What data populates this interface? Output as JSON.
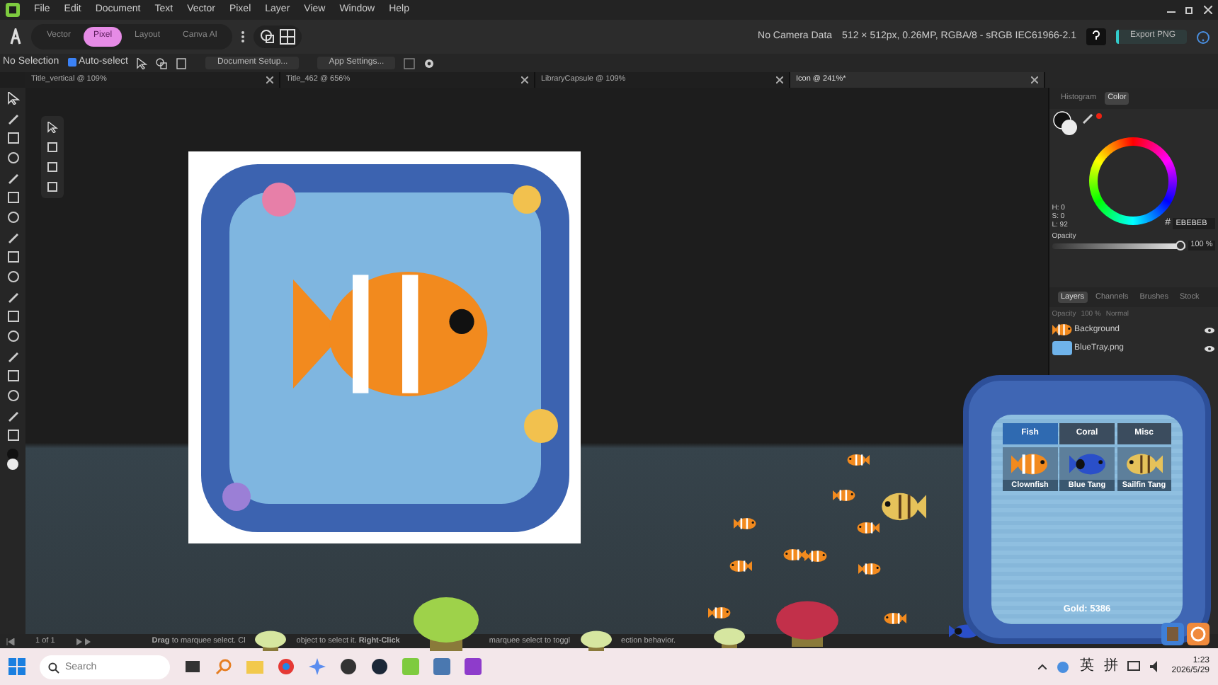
{
  "menu": [
    "File",
    "Edit",
    "Document",
    "Text",
    "Vector",
    "Pixel",
    "Layer",
    "View",
    "Window",
    "Help"
  ],
  "personas": [
    {
      "label": "Vector",
      "selected": false
    },
    {
      "label": "Pixel",
      "selected": true
    },
    {
      "label": "Layout",
      "selected": false
    },
    {
      "label": "Canva AI",
      "selected": false
    }
  ],
  "toolbar_info": [
    "No Camera Data",
    "512 × 512px, 0.26MP, RGBA/8 - sRGB IEC61966-2.1"
  ],
  "export_button": "Export PNG",
  "context_bar": {
    "selection": "No Selection",
    "auto_select": {
      "label": "Auto-select",
      "checked": true
    },
    "buttons": [
      "Document Setup...",
      "App Settings..."
    ]
  },
  "document_tabs": [
    {
      "title": "Title_vertical @ 109%",
      "selected": false
    },
    {
      "title": "Title_462 @ 656%",
      "selected": false
    },
    {
      "title": "LibraryCapsule @ 109%",
      "selected": false
    },
    {
      "title": "Icon @ 241%*",
      "selected": true
    }
  ],
  "color_panel": {
    "tabs": [
      {
        "label": "Histogram",
        "selected": false
      },
      {
        "label": "Color",
        "selected": true
      }
    ],
    "hsl": [
      "H: 0",
      "S: 0",
      "L: 92"
    ],
    "hex_prefix": "#",
    "hex": "EBEBEB",
    "opacity_label": "Opacity",
    "opacity": {
      "level": 1,
      "reading": "100 %"
    }
  },
  "layers_panel": {
    "tabs": [
      {
        "label": "Layers",
        "selected": true
      },
      {
        "label": "Channels",
        "selected": false
      },
      {
        "label": "Brushes",
        "selected": false
      },
      {
        "label": "Stock",
        "selected": false
      }
    ],
    "opacity_label": "Opacity",
    "opacity": "100 %",
    "blend_mode": "Normal",
    "layers": [
      {
        "name": "Background",
        "kind": "fish"
      },
      {
        "name": "BlueTray.png",
        "kind": "tray"
      }
    ]
  },
  "status_bar": {
    "page": "1 of 1",
    "hint_parts": [
      "**Drag** to marquee select. Cl",
      "object to select it. **Right-Click**",
      "marquee select to toggl",
      "ection behavior."
    ]
  },
  "aquarium_shop": {
    "tabs": [
      {
        "label": "Fish",
        "selected": true
      },
      {
        "label": "Coral",
        "selected": false
      },
      {
        "label": "Misc",
        "selected": false
      }
    ],
    "items": [
      {
        "name": "Clownfish",
        "kind": "clownfish"
      },
      {
        "name": "Blue Tang",
        "kind": "bluetang"
      },
      {
        "name": "Sailfin Tang",
        "kind": "sailfin"
      }
    ],
    "gold": "Gold: 5386"
  },
  "taskbar": {
    "search_placeholder": "Search",
    "ime": [
      "英",
      "拼"
    ],
    "time": "1:23",
    "date": "2026/5/29"
  }
}
